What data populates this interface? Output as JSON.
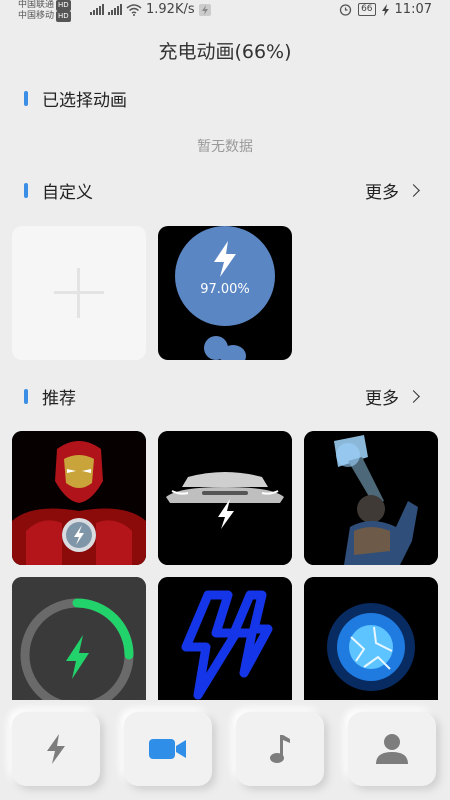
{
  "status_bar": {
    "carrier1": "中国联通",
    "carrier2": "中国移动",
    "hd": "HD",
    "net_type": "4G",
    "speed": "1.92K/s",
    "battery": "66",
    "time": "11:07"
  },
  "header": {
    "title": "充电动画(66%)"
  },
  "sections": {
    "selected": {
      "title": "已选择动画",
      "empty_text": "暂无数据"
    },
    "custom": {
      "title": "自定义",
      "more_label": "更多",
      "battery_percent": "97.00%"
    },
    "recommended": {
      "title": "推荐",
      "more_label": "更多"
    }
  },
  "colors": {
    "accent": "#3a8ee6",
    "active_tab": "#2e8ee8",
    "inactive_tab": "#7d7d7d",
    "battery_blue": "#5b86c4",
    "ring_green": "#22d36b",
    "bolt_blue": "#1535e8"
  },
  "tabs": [
    {
      "icon": "lightning-icon",
      "active": false
    },
    {
      "icon": "video-camera-icon",
      "active": true
    },
    {
      "icon": "music-note-icon",
      "active": false
    },
    {
      "icon": "person-icon",
      "active": false
    }
  ]
}
